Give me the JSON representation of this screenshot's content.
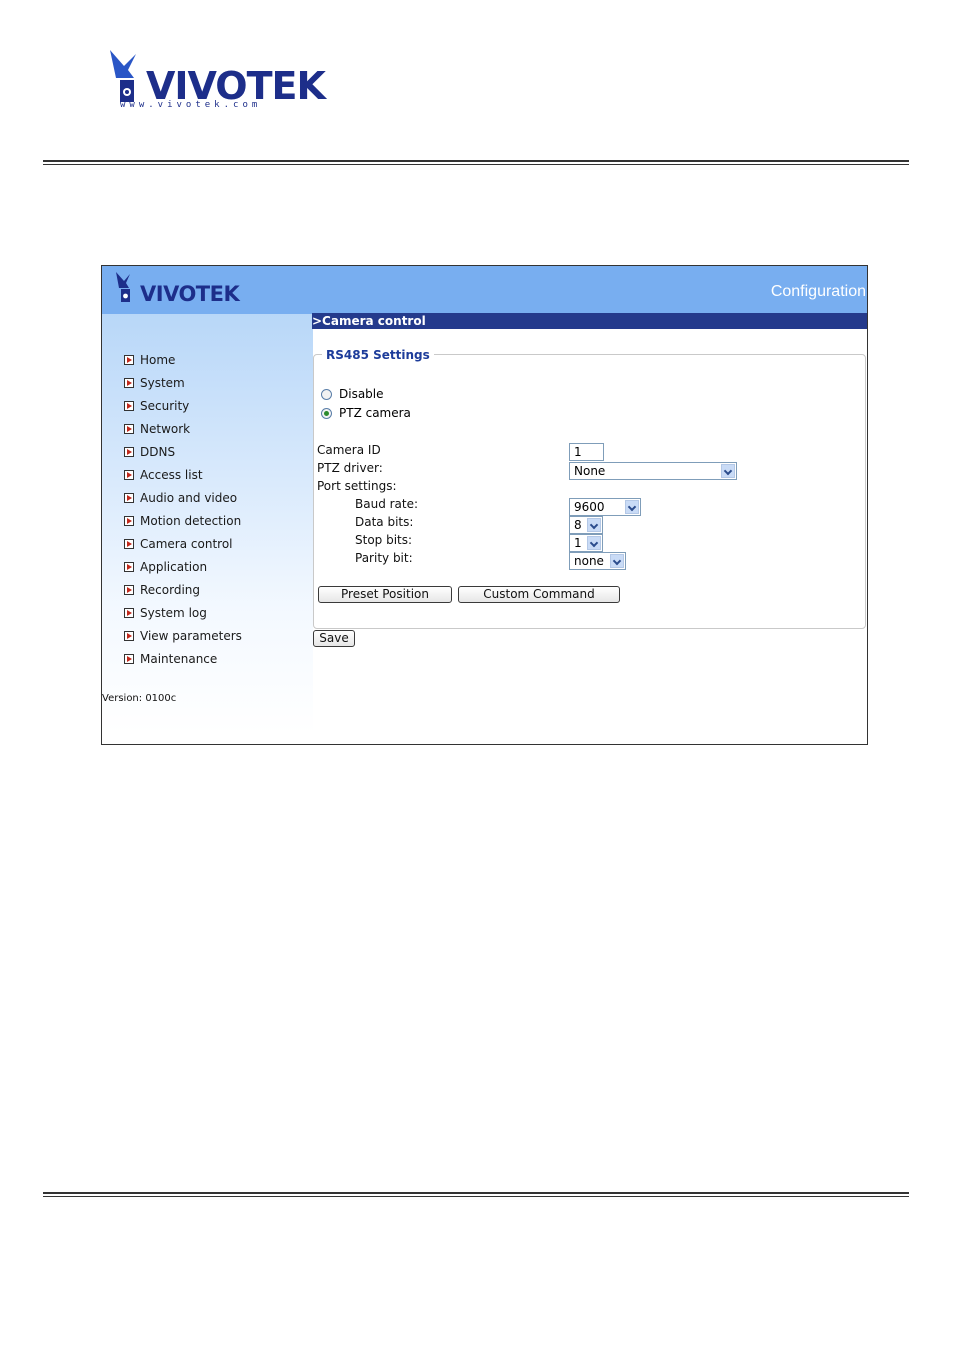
{
  "document": {
    "logo": {
      "brand": "VIVOTEK",
      "url": "www.vivotek.com"
    }
  },
  "app": {
    "logo_text": "VIVOTEK",
    "header_title": "Configuration",
    "section_title": ">Camera control",
    "version": "Version: 0100c"
  },
  "colors": {
    "banner": "#78aef0",
    "section_bar": "#243a8c",
    "legend": "#1d3c9a",
    "logo": "#1d2e8a"
  },
  "sidebar": {
    "items": [
      {
        "label": "Home"
      },
      {
        "label": "System"
      },
      {
        "label": "Security"
      },
      {
        "label": "Network"
      },
      {
        "label": "DDNS"
      },
      {
        "label": "Access list"
      },
      {
        "label": "Audio and video"
      },
      {
        "label": "Motion detection"
      },
      {
        "label": "Camera control"
      },
      {
        "label": "Application"
      },
      {
        "label": "Recording"
      },
      {
        "label": "System log"
      },
      {
        "label": "View parameters"
      },
      {
        "label": "Maintenance"
      }
    ]
  },
  "rs485": {
    "legend": "RS485 Settings",
    "options": [
      {
        "label": "Disable",
        "selected": false
      },
      {
        "label": "PTZ camera",
        "selected": true
      }
    ],
    "camera_id_label": "Camera ID",
    "camera_id_value": "1",
    "ptz_driver_label": "PTZ driver:",
    "ptz_driver_value": "None",
    "port_settings_label": "Port settings:",
    "baud_rate_label": "Baud rate:",
    "baud_rate_value": "9600",
    "data_bits_label": "Data bits:",
    "data_bits_value": "8",
    "stop_bits_label": "Stop bits:",
    "stop_bits_value": "1",
    "parity_bit_label": "Parity bit:",
    "parity_bit_value": "none",
    "preset_button": "Preset Position",
    "custom_button": "Custom Command"
  },
  "save_button": "Save"
}
